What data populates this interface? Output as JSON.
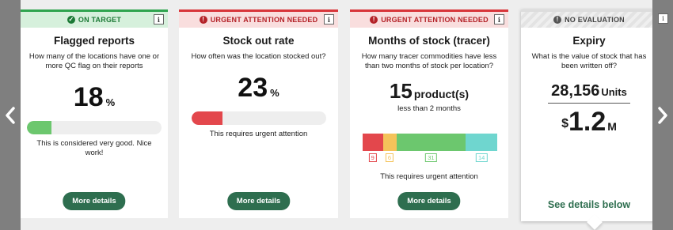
{
  "navigation": {
    "prev_icon": "chevron-left-icon",
    "next_icon": "chevron-right-icon"
  },
  "colors": {
    "brand_green": "#2e6e4f",
    "on_target": "#2fa44f",
    "urgent": "#d8353a",
    "no_eval": "#dddddd"
  },
  "cards": [
    {
      "status": "ON TARGET",
      "status_icon": "check-circle-icon",
      "info_label": "i",
      "title": "Flagged reports",
      "question": "How many of the locations have one or more QC flag on their reports",
      "value": "18",
      "unit": "%",
      "progress": 0.18,
      "comment": "This is considered very good. Nice work!",
      "button": "More details"
    },
    {
      "status": "URGENT ATTENTION NEEDED",
      "status_icon": "alert-circle-icon",
      "info_label": "i",
      "title": "Stock out rate",
      "question": "How often was the location stocked out?",
      "value": "23",
      "unit": "%",
      "progress": 0.23,
      "comment": "This requires urgent attention",
      "button": "More details"
    },
    {
      "status": "URGENT ATTENTION NEEDED",
      "status_icon": "alert-circle-icon",
      "info_label": "i",
      "title": "Months of stock (tracer)",
      "question": "How many tracer commodities have less than two months of stock per location?",
      "value": "15",
      "unit": "product(s)",
      "subtitle": "less than 2 months",
      "segments": [
        {
          "value": 9,
          "label": "9",
          "color": "#e3474c"
        },
        {
          "value": 6,
          "label": "6",
          "color": "#f4c35a"
        },
        {
          "value": 31,
          "label": "31",
          "color": "#6cc76e"
        },
        {
          "value": 14,
          "label": "14",
          "color": "#6fd6cf"
        }
      ],
      "comment": "This requires urgent attention",
      "button": "More details"
    },
    {
      "status": "NO EVALUATION",
      "status_icon": "info-circle-icon",
      "title": "Expiry",
      "question": "What is the value of stock that has been written off?",
      "units_value": "28,156",
      "units_suffix": "Units",
      "money_symbol": "$",
      "money_value": "1.2",
      "money_suffix": "M",
      "link": "See details below"
    }
  ],
  "edge_info_label": "i"
}
